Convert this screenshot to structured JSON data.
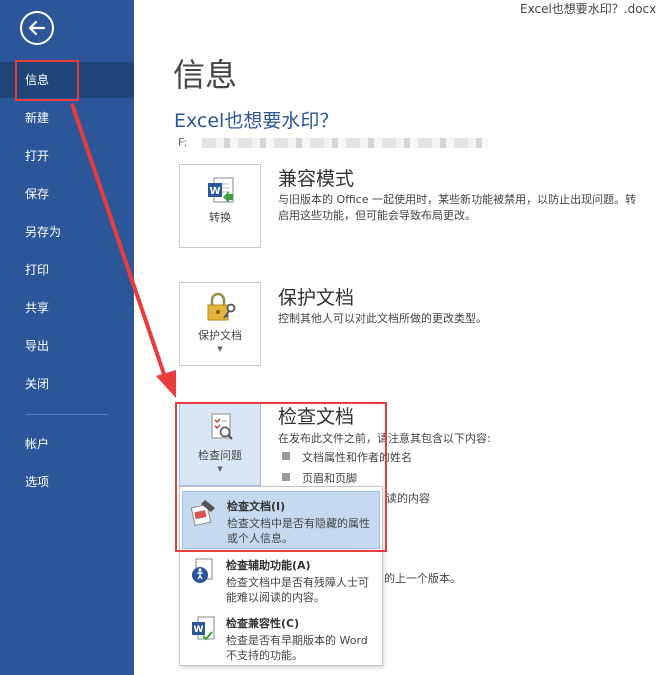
{
  "window": {
    "title": "Excel也想要水印？.docx ["
  },
  "nav": {
    "back_icon": "arrow-left-circle-icon",
    "items": [
      {
        "label": "信息"
      },
      {
        "label": "新建"
      },
      {
        "label": "打开"
      },
      {
        "label": "保存"
      },
      {
        "label": "另存为"
      },
      {
        "label": "打印"
      },
      {
        "label": "共享"
      },
      {
        "label": "导出"
      },
      {
        "label": "关闭"
      },
      {
        "label": "帐户"
      },
      {
        "label": "选项"
      }
    ]
  },
  "main": {
    "page_title": "信息",
    "doc_title": "Excel也想要水印？",
    "doc_path_prefix": "F:",
    "compat": {
      "button_label": "转换",
      "title": "兼容模式",
      "desc_line1": "与旧版本的 Office 一起使用时，某些新功能被禁用，以防止出现问题。转",
      "desc_line2": "启用这些功能，但可能会导致布局更改。"
    },
    "protect": {
      "button_label": "保护文档",
      "title": "保护文档",
      "desc": "控制其他人可以对此文档所做的更改类型。"
    },
    "inspect": {
      "button_label": "检查问题",
      "title": "检查文档",
      "desc": "在发布此文件之前，请注意其包含以下内容:",
      "bullets": [
        "文档属性和作者的姓名",
        "页眉和页脚"
      ],
      "partial_text1": "读的内容",
      "partial_text2": "的上一个版本。"
    }
  },
  "dropdown": {
    "items": [
      {
        "title": "检查文档(I)",
        "desc": "检查文档中是否有隐藏的属性或个人信息。",
        "icon": "inspect-document-icon"
      },
      {
        "title": "检查辅助功能(A)",
        "desc": "检查文档中是否有残障人士可能难以阅读的内容。",
        "icon": "accessibility-check-icon"
      },
      {
        "title": "检查兼容性(C)",
        "desc": "检查是否有早期版本的 Word 不支持的功能。",
        "icon": "compatibility-check-icon"
      }
    ]
  },
  "colors": {
    "sidebar": "#2b579a",
    "accent_title": "#2b579a",
    "annotation_red": "#ea3c3c",
    "highlight": "#c5d9f1"
  }
}
